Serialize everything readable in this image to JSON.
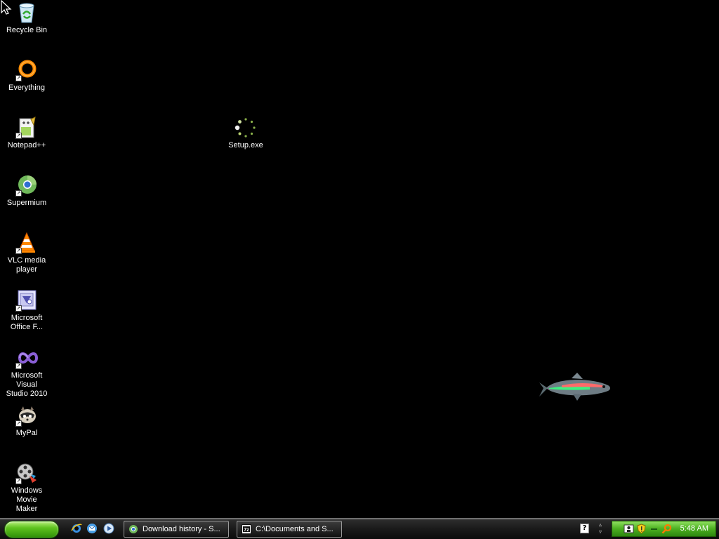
{
  "desktop": {
    "background_color": "#000000",
    "icons": [
      {
        "label": "Recycle Bin",
        "icon": "recycle-bin-icon"
      },
      {
        "label": "Everything",
        "icon": "everything-icon"
      },
      {
        "label": "Notepad++",
        "icon": "notepad-plus-plus-icon"
      },
      {
        "label": "Supermium",
        "icon": "supermium-icon"
      },
      {
        "label": "VLC media\nplayer",
        "icon": "vlc-icon"
      },
      {
        "label": "Microsoft\nOffice F...",
        "icon": "office-icon"
      },
      {
        "label": "Microsoft Visual\nStudio 2010",
        "icon": "visual-studio-icon"
      },
      {
        "label": "MyPal",
        "icon": "mypal-icon"
      },
      {
        "label": "Windows Movie\nMaker",
        "icon": "movie-maker-icon"
      },
      {
        "label": "Setup.exe",
        "icon": "setup-loading-icon"
      }
    ]
  },
  "taskbar": {
    "quick_launch": [
      "ie-icon",
      "email-icon",
      "media-player-icon"
    ],
    "buttons": [
      {
        "label": "Download history - S...",
        "icon": "browser-icon"
      },
      {
        "label": "C:\\Documents and S...",
        "icon": "7zip-icon"
      }
    ],
    "help_label": "?",
    "tray_icons": [
      "network-icon",
      "shield-icon",
      "dash-icon",
      "search-icon"
    ],
    "clock": "5:48 AM",
    "accent_color": "#4bb020"
  }
}
